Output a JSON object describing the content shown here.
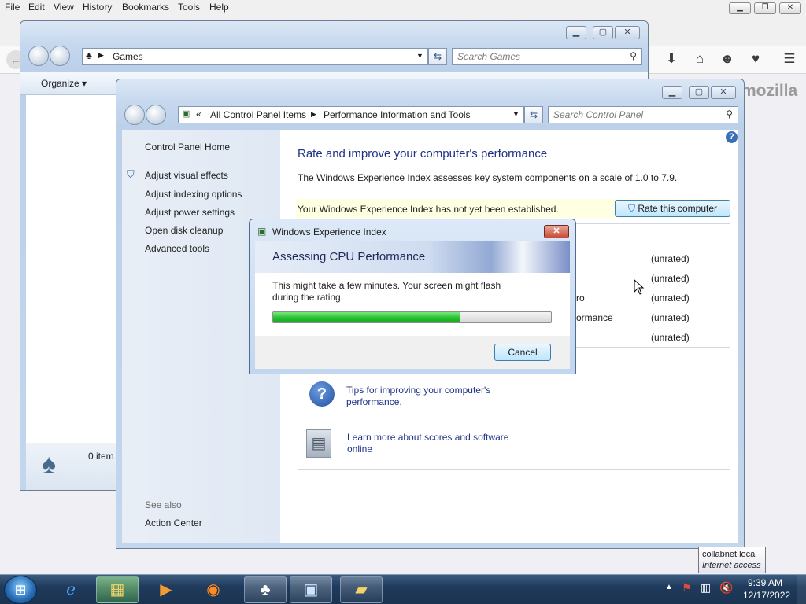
{
  "firefox": {
    "menu": [
      "File",
      "Edit",
      "View",
      "History",
      "Bookmarks",
      "Tools",
      "Help"
    ],
    "brand": "mozilla"
  },
  "explorer": {
    "address": "Games",
    "search_placeholder": "Search Games",
    "organize_label": "Organize",
    "status_text": "0 item"
  },
  "control_panel": {
    "breadcrumb": {
      "root_symbol": "«",
      "items": [
        "All Control Panel Items",
        "Performance Information and Tools"
      ]
    },
    "search_placeholder": "Search Control Panel",
    "sidebar": {
      "home": "Control Panel Home",
      "links": [
        "Adjust visual effects",
        "Adjust indexing options",
        "Adjust power settings",
        "Open disk cleanup",
        "Advanced tools"
      ],
      "see_also_label": "See also",
      "see_also_links": [
        "Action Center"
      ]
    },
    "main": {
      "title": "Rate and improve your computer's performance",
      "description": "The Windows Experience Index assesses key system components on a scale of 1.0 to 7.9.",
      "notice": "Your Windows Experience Index has not yet been established.",
      "rate_button": "Rate this computer",
      "component_partials": [
        "ro",
        "ormance"
      ],
      "scores": [
        "(unrated)",
        "(unrated)",
        "(unrated)",
        "(unrated)",
        "(unrated)"
      ],
      "tips_link": "Tips for improving your computer's performance.",
      "learn_more_link": "Learn more about scores and software online"
    }
  },
  "dialog": {
    "title": "Windows Experience Index",
    "heading": "Assessing CPU Performance",
    "message": "This might take a few minutes. Your screen might flash during the rating.",
    "progress_fraction": 0.67,
    "cancel_label": "Cancel"
  },
  "tooltip": {
    "line1": "collabnet.local",
    "line2": "Internet access"
  },
  "taskbar": {
    "clock_time": "9:39 AM",
    "clock_date": "12/17/2022",
    "buttons": [
      "start-orb",
      "internet-explorer",
      "windows-explorer",
      "media-player",
      "firefox",
      "control-panel-games",
      "control-panel",
      "folder"
    ]
  },
  "colors": {
    "link": "#1e3287",
    "progress": "#25c12f",
    "taskbar": "#1f3a5c"
  }
}
